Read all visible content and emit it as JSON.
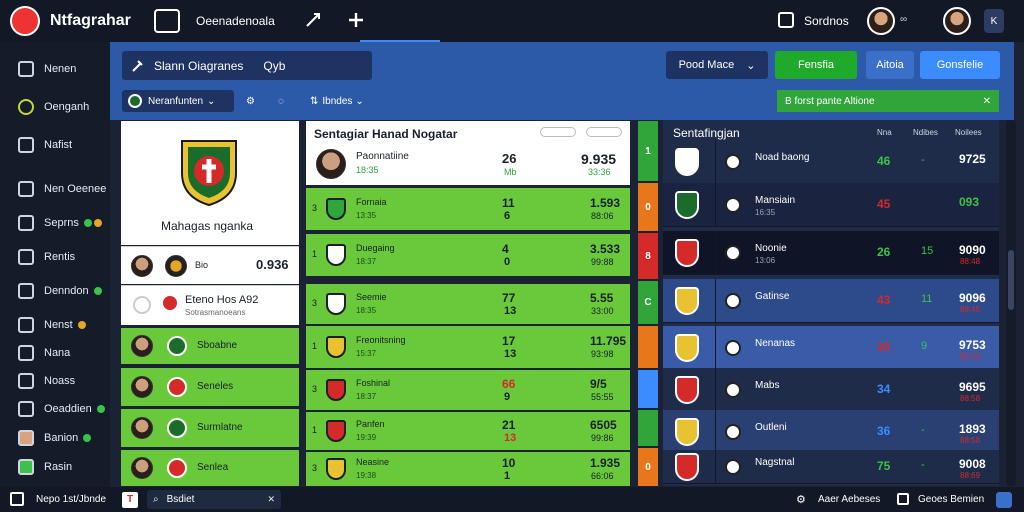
{
  "app": {
    "title": "Ntfagrahar",
    "tab_label": "Oeenadenoala",
    "top_right_label": "Sordnos"
  },
  "search": {
    "label": "Slann Oiagranes",
    "hint": "Qyb"
  },
  "header_buttons": {
    "dropdown": "Pood Mace",
    "green": "Fensfia",
    "blue1": "Aitoia",
    "blue2": "Gonsfelie"
  },
  "subbar": {
    "filter": "Neranfunten",
    "filter2": "Ibndes",
    "green_bar": "B forst pante Altione"
  },
  "sidebar": {
    "items": [
      {
        "label": "Nenen",
        "icon": "home-icon"
      },
      {
        "label": "Oenganh",
        "icon": "trophy-icon"
      },
      {
        "label": "Nafist",
        "icon": "list-icon"
      },
      {
        "label": "Nen Oeenee",
        "icon": "calendar-icon"
      },
      {
        "label": "Seprns",
        "icon": "user-icon"
      },
      {
        "label": "Rentis",
        "icon": "stats-icon"
      },
      {
        "label": "Denndon",
        "icon": "chart-icon"
      },
      {
        "label": "Nenst",
        "icon": "shield-icon"
      },
      {
        "label": "Nana",
        "icon": "grid-icon"
      },
      {
        "label": "Noass",
        "icon": "menu-icon"
      },
      {
        "label": "Oeaddien",
        "icon": "gear-icon"
      },
      {
        "label": "Banion",
        "icon": "team-icon"
      },
      {
        "label": "Rasin",
        "icon": "flag-icon"
      }
    ]
  },
  "club_card": {
    "name": "Mahagas nganka",
    "row1": {
      "score": "0.936",
      "label": "Bio"
    },
    "row2": {
      "name": "Eteno Hos A92",
      "sub": "Sotrasmanoeans"
    },
    "rows": [
      {
        "label": "Sboabne"
      },
      {
        "label": "Seneles"
      },
      {
        "label": "Surmlatne"
      },
      {
        "label": "Senlea"
      }
    ]
  },
  "match_panel": {
    "title": "Sentagiar Hanad Nogatar",
    "header_value": "26",
    "header_value_sub": "Mb",
    "header_right": "9.935",
    "header_right_sub": "33:36",
    "featured_name": "Paonnatiine",
    "featured_sub": "18:35",
    "rows": [
      {
        "name": "Fornaia",
        "sub": "13:35",
        "val": "11",
        "val2": "6",
        "right": "1.593",
        "right_sub": "88:06"
      },
      {
        "name": "Duegaing",
        "sub": "18:37",
        "val": "4",
        "val2": "0",
        "right": "3.533",
        "right_sub": "99:88"
      },
      {
        "name": "Seemie",
        "sub": "18:35",
        "val": "77",
        "val2": "13",
        "right": "5.55",
        "right_sub": "33:00"
      },
      {
        "name": "Freonitsning",
        "sub": "15:37",
        "val": "17",
        "val2": "13",
        "right": "11.795",
        "right_sub": "93:98"
      },
      {
        "name": "Foshinal",
        "sub": "18:37",
        "val": "66",
        "val2": "9",
        "right": "9/5",
        "right_sub": "55:55"
      },
      {
        "name": "Panfen",
        "sub": "19:39",
        "val": "21",
        "val2": "13",
        "right": "6505",
        "right_sub": "99:86"
      },
      {
        "name": "Neasine",
        "sub": "19:38",
        "val": "10",
        "val2": "1",
        "right": "1.935",
        "right_sub": "66:06"
      }
    ]
  },
  "right_table": {
    "title": "Sentafingjan",
    "cols": [
      "Nna",
      "Ndibes",
      "Noilees"
    ],
    "rows": [
      {
        "name": "Noad baong",
        "sub": "",
        "v1": "46",
        "v2": "-",
        "right": "9725",
        "right_sub": ""
      },
      {
        "name": "Mansiain",
        "sub": "16:35",
        "v1": "45",
        "v2": "",
        "right": "093",
        "right_sub": ""
      },
      {
        "name": "Noonie",
        "sub": "13:06",
        "v1": "26",
        "v2": "15",
        "right": "9090",
        "right_sub": "88:48"
      },
      {
        "name": "Gatinse",
        "sub": "",
        "v1": "43",
        "v2": "11",
        "right": "9096",
        "right_sub": "88:45"
      },
      {
        "name": "Nenanas",
        "sub": "",
        "v1": "30",
        "v2": "9",
        "right": "9753",
        "right_sub": "95:50"
      },
      {
        "name": "Mabs",
        "sub": "",
        "v1": "34",
        "v2": "",
        "right": "9695",
        "right_sub": "88:58"
      },
      {
        "name": "Outleni",
        "sub": "",
        "v1": "36",
        "v2": "-",
        "right": "1893",
        "right_sub": "88:58"
      },
      {
        "name": "Nagstnal",
        "sub": "",
        "v1": "75",
        "v2": "-",
        "right": "9008",
        "right_sub": "88:69"
      }
    ],
    "strip": [
      "1",
      "0",
      "8",
      "C",
      "",
      "",
      "",
      "0"
    ]
  },
  "footer": {
    "left": "Nepo 1st/Jbnde",
    "search": "Bsdiet",
    "right1": "Aaer Aebeses",
    "right2": "Geoes Bemien"
  },
  "colors": {
    "green": "#69c93b",
    "blue": "#2d5aa8",
    "dark": "#1e2c4a"
  }
}
